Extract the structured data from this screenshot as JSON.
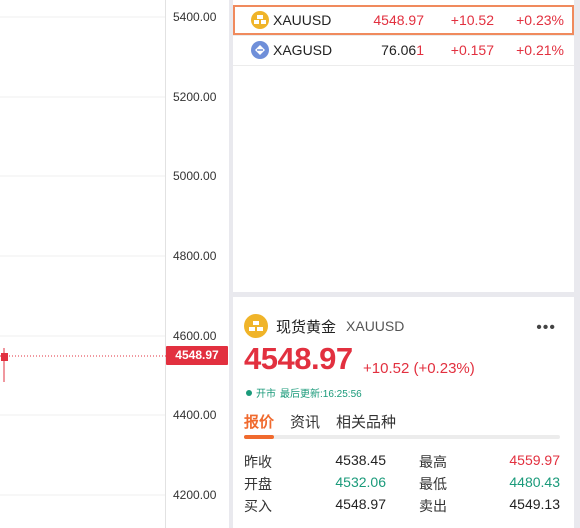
{
  "chart": {
    "y_ticks": [
      "5400.00",
      "5200.00",
      "5000.00",
      "4800.00",
      "4600.00",
      "4400.00",
      "4200.00"
    ],
    "last_price_tag": "4548.97",
    "colors": {
      "up": "#e2303f",
      "grid": "#efefef"
    }
  },
  "watchlist": {
    "rows": [
      {
        "symbol": "XAUUSD",
        "price": "4548.97",
        "change": "+10.52",
        "pct": "+0.23%",
        "icon": "gold-icon",
        "selected": true
      },
      {
        "symbol": "XAGUSD",
        "price_main": "76.06",
        "price_tail": "1",
        "change": "+0.157",
        "pct": "+0.21%",
        "icon": "silver-icon",
        "selected": false
      }
    ]
  },
  "detail": {
    "name": "现货黄金",
    "code": "XAUUSD",
    "more": "•••",
    "price": "4548.97",
    "change": "+10.52 (+0.23%)",
    "status": "开市",
    "updated": "最后更新:16:25:56",
    "tabs": [
      "报价",
      "资讯",
      "相关品种"
    ],
    "quotes": [
      {
        "l1": "昨收",
        "v1": "4538.45",
        "l2": "最高",
        "v2": "4559.97"
      },
      {
        "l1": "开盘",
        "v1": "4532.06",
        "l2": "最低",
        "v2": "4480.43"
      },
      {
        "l1": "买入",
        "v1": "4548.97",
        "l2": "卖出",
        "v2": "4549.13"
      }
    ],
    "colors": {
      "accent": "#f06a2e",
      "up": "#e2303f",
      "down": "#1a9a7a"
    }
  }
}
